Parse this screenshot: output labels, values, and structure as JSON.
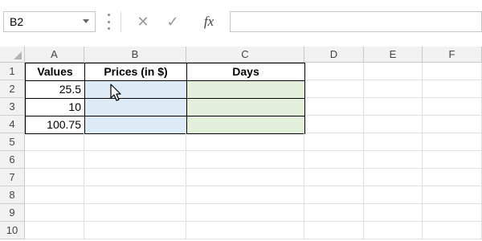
{
  "formula_bar": {
    "name_box": "B2",
    "cancel_icon": "✕",
    "enter_icon": "✓",
    "function_icon": "fx",
    "formula": ""
  },
  "columns": [
    "A",
    "B",
    "C",
    "D",
    "E",
    "F"
  ],
  "rows": [
    "1",
    "2",
    "3",
    "4",
    "5",
    "6",
    "7",
    "8",
    "9",
    "10"
  ],
  "cells": {
    "A1": "Values",
    "B1": "Prices (in $)",
    "C1": "Days",
    "A2": "25.5",
    "A3": "10",
    "A4": "100.75"
  },
  "colors": {
    "price_fill": "#ddebf7",
    "days_fill": "#e2efda",
    "header_bg": "#f2f2f2",
    "gridline": "#e1e1e1"
  },
  "icons": {
    "cursor": "mouse-pointer-icon"
  }
}
